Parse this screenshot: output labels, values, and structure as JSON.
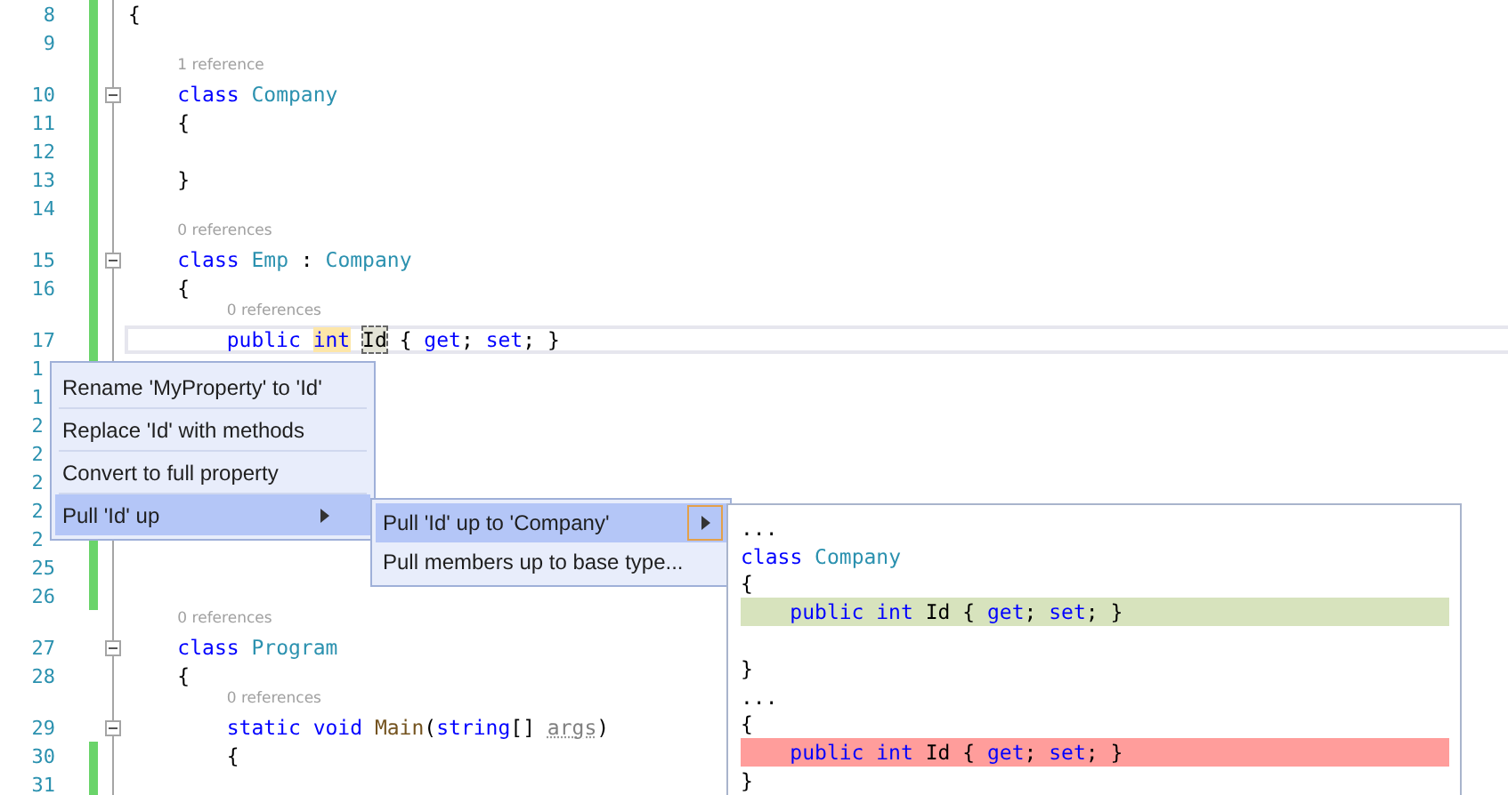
{
  "editor": {
    "lines": [
      {
        "number": "8",
        "change": true,
        "kind": "namespace",
        "tokens": [
          {
            "t": "{",
            "kind": "plain"
          }
        ]
      },
      {
        "number": "9",
        "change": true
      },
      {
        "number": "10",
        "change": true,
        "fold": true,
        "kind": "type",
        "lens": "1 reference",
        "tokens": [
          {
            "t": "class ",
            "kind": "keyword"
          },
          {
            "t": "Company",
            "kind": "type"
          }
        ]
      },
      {
        "number": "11",
        "change": true,
        "kind": "type",
        "tokens": [
          {
            "t": "{",
            "kind": "plain"
          }
        ]
      },
      {
        "number": "12",
        "change": true
      },
      {
        "number": "13",
        "change": true,
        "kind": "type",
        "tokens": [
          {
            "t": "}",
            "kind": "plain"
          }
        ]
      },
      {
        "number": "14",
        "change": true
      },
      {
        "number": "15",
        "change": true,
        "fold": true,
        "kind": "type",
        "lens": "0 references",
        "tokens": [
          {
            "t": "class ",
            "kind": "keyword"
          },
          {
            "t": "Emp",
            "kind": "type"
          },
          {
            "t": " : ",
            "kind": "plain"
          },
          {
            "t": "Company",
            "kind": "type"
          }
        ]
      },
      {
        "number": "16",
        "change": true,
        "kind": "type",
        "tokens": [
          {
            "t": "{",
            "kind": "plain"
          }
        ]
      },
      {
        "number": "17",
        "change": true,
        "current": true,
        "kind": "member",
        "lens": "0 references",
        "tokens": [
          {
            "t": "public ",
            "kind": "keyword"
          },
          {
            "t": "int",
            "kind": "keyword",
            "highlighted": true
          },
          {
            "t": "Id",
            "kind": "plain",
            "rename_target": true
          },
          {
            "t": " { ",
            "kind": "plain"
          },
          {
            "t": "get",
            "kind": "keyword"
          },
          {
            "t": "; ",
            "kind": "plain"
          },
          {
            "t": "set",
            "kind": "keyword"
          },
          {
            "t": "; }",
            "kind": "plain"
          }
        ]
      },
      {
        "number": "1",
        "cut": true,
        "change": true
      },
      {
        "number": "1",
        "cut": true,
        "change": true
      },
      {
        "number": "2",
        "cut": true,
        "change": true
      },
      {
        "number": "2",
        "cut": true,
        "change": true
      },
      {
        "number": "2",
        "cut": true,
        "change": true
      },
      {
        "number": "2",
        "cut": true,
        "change": true
      },
      {
        "number": "2",
        "cut": true,
        "change": true
      },
      {
        "number": "25",
        "change": true
      },
      {
        "number": "26",
        "change": true
      },
      {
        "number": "27",
        "change": false,
        "fold": true,
        "kind": "type",
        "lens": "0 references",
        "tokens": [
          {
            "t": "class ",
            "kind": "keyword"
          },
          {
            "t": "Program",
            "kind": "type"
          }
        ]
      },
      {
        "number": "28",
        "change": false,
        "kind": "type",
        "tokens": [
          {
            "t": "{",
            "kind": "plain"
          }
        ]
      },
      {
        "number": "29",
        "change": false,
        "fold": true,
        "kind": "member",
        "lens": "0 references",
        "tokens": [
          {
            "t": "static void ",
            "kind": "keyword"
          },
          {
            "t": "Main",
            "kind": "method"
          },
          {
            "t": "(",
            "kind": "plain"
          },
          {
            "t": "string",
            "kind": "keyword"
          },
          {
            "t": "[] ",
            "kind": "plain"
          },
          {
            "t": "args",
            "kind": "param"
          },
          {
            "t": ")",
            "kind": "plain"
          }
        ]
      },
      {
        "number": "30",
        "change": true,
        "kind": "member",
        "tokens": [
          {
            "t": "{",
            "kind": "plain"
          }
        ]
      },
      {
        "number": "31",
        "change": true
      }
    ]
  },
  "context_menu": {
    "items": [
      {
        "label": "Rename 'MyProperty' to 'Id'",
        "selected": false
      },
      {
        "label": "Replace 'Id' with methods",
        "selected": false
      },
      {
        "label": "Convert to full property",
        "selected": false
      },
      {
        "label": "Pull 'Id' up",
        "selected": true,
        "submenu": true
      }
    ]
  },
  "submenu": {
    "items": [
      {
        "label": "Pull 'Id' up to 'Company'",
        "selected": true,
        "submenu": true
      },
      {
        "label": "Pull members up to base type...",
        "selected": false
      }
    ]
  },
  "preview": {
    "lines": [
      {
        "kind": "namespace",
        "tokens": [
          {
            "t": "...",
            "kind": "plain"
          }
        ]
      },
      {
        "kind": "namespace",
        "tokens": [
          {
            "t": "class ",
            "kind": "keyword"
          },
          {
            "t": "Company",
            "kind": "type"
          }
        ]
      },
      {
        "kind": "namespace",
        "tokens": [
          {
            "t": "{",
            "kind": "plain"
          }
        ]
      },
      {
        "added": true,
        "kind": "type",
        "tokens": [
          {
            "t": "public int ",
            "kind": "keyword"
          },
          {
            "t": "Id { ",
            "kind": "plain"
          },
          {
            "t": "get",
            "kind": "keyword"
          },
          {
            "t": "; ",
            "kind": "plain"
          },
          {
            "t": "set",
            "kind": "keyword"
          },
          {
            "t": "; }",
            "kind": "plain"
          }
        ]
      },
      {
        "kind": "blank"
      },
      {
        "kind": "namespace",
        "tokens": [
          {
            "t": "}",
            "kind": "plain"
          }
        ]
      },
      {
        "kind": "namespace",
        "tokens": [
          {
            "t": "...",
            "kind": "plain"
          }
        ]
      },
      {
        "kind": "namespace",
        "tokens": [
          {
            "t": "{",
            "kind": "plain"
          }
        ]
      },
      {
        "removed": true,
        "kind": "type",
        "tokens": [
          {
            "t": "public int ",
            "kind": "keyword"
          },
          {
            "t": "Id { ",
            "kind": "plain"
          },
          {
            "t": "get",
            "kind": "keyword"
          },
          {
            "t": "; ",
            "kind": "plain"
          },
          {
            "t": "set",
            "kind": "keyword"
          },
          {
            "t": "; }",
            "kind": "plain"
          }
        ]
      },
      {
        "kind": "namespace",
        "tokens": [
          {
            "t": "}",
            "kind": "plain"
          }
        ]
      }
    ]
  }
}
